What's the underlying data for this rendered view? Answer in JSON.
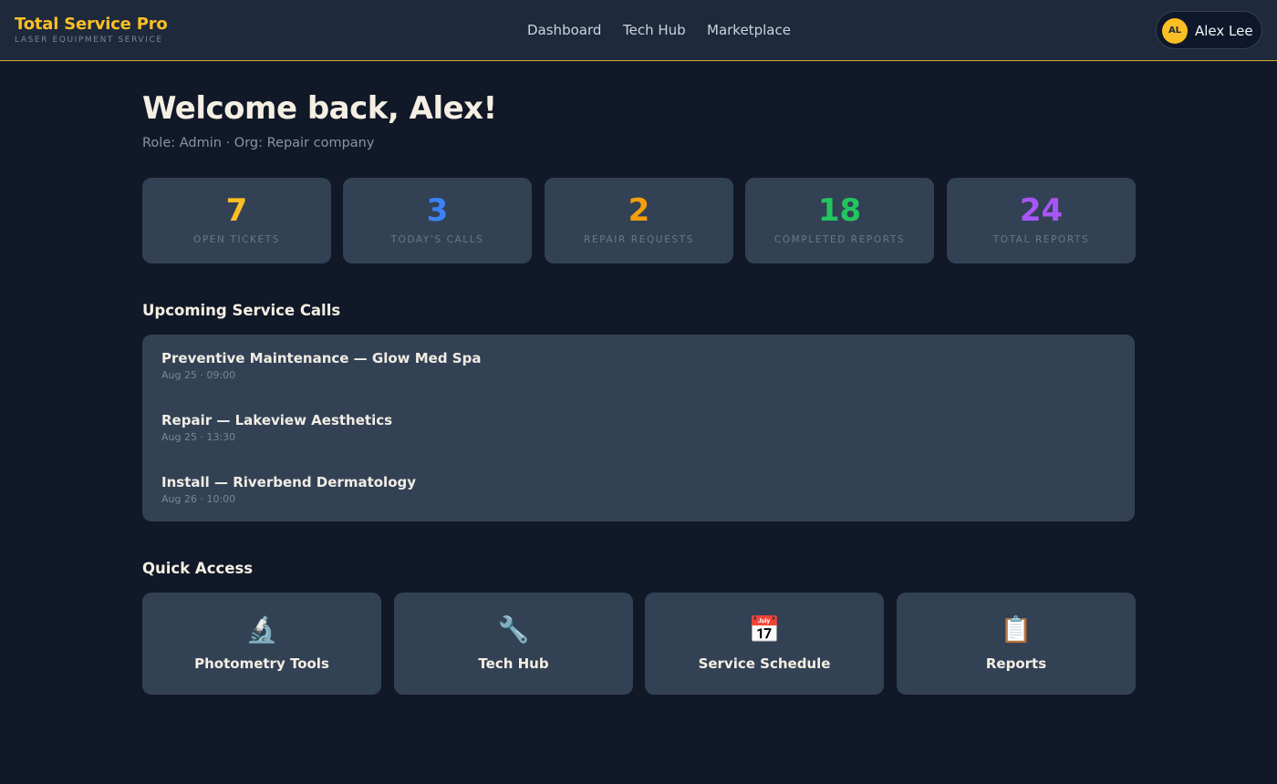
{
  "brand": {
    "title": "Total Service Pro",
    "subtitle": "LASER EQUIPMENT SERVICE"
  },
  "nav": {
    "items": [
      "Dashboard",
      "Tech Hub",
      "Marketplace"
    ]
  },
  "user": {
    "initials": "AL",
    "name": "Alex Lee"
  },
  "welcome": {
    "title": "Welcome back, Alex!",
    "role_line": "Role: Admin · Org: Repair company"
  },
  "stats": [
    {
      "value": "7",
      "label": "OPEN TICKETS",
      "color": "#fbbf24"
    },
    {
      "value": "3",
      "label": "TODAY'S CALLS",
      "color": "#3b82f6"
    },
    {
      "value": "2",
      "label": "REPAIR REQUESTS",
      "color": "#f59e0b"
    },
    {
      "value": "18",
      "label": "COMPLETED REPORTS",
      "color": "#22c55e"
    },
    {
      "value": "24",
      "label": "TOTAL REPORTS",
      "color": "#a855f7"
    }
  ],
  "upcoming": {
    "title": "Upcoming Service Calls",
    "items": [
      {
        "title": "Preventive Maintenance — Glow Med Spa",
        "time": "Aug 25 · 09:00"
      },
      {
        "title": "Repair — Lakeview Aesthetics",
        "time": "Aug 25 · 13:30"
      },
      {
        "title": "Install — Riverbend Dermatology",
        "time": "Aug 26 · 10:00"
      }
    ]
  },
  "quick_access": {
    "title": "Quick Access",
    "items": [
      {
        "icon": "microscope-icon",
        "glyph": "🔬",
        "label": "Photometry Tools"
      },
      {
        "icon": "wrench-icon",
        "glyph": "🔧",
        "label": "Tech Hub"
      },
      {
        "icon": "calendar-icon",
        "glyph": "📅",
        "label": "Service Schedule"
      },
      {
        "icon": "clipboard-icon",
        "glyph": "📋",
        "label": "Reports"
      }
    ]
  },
  "colors": {
    "accent": "#fbbf24",
    "background": "#111827",
    "card": "#334155",
    "topbar": "#1e293b"
  }
}
